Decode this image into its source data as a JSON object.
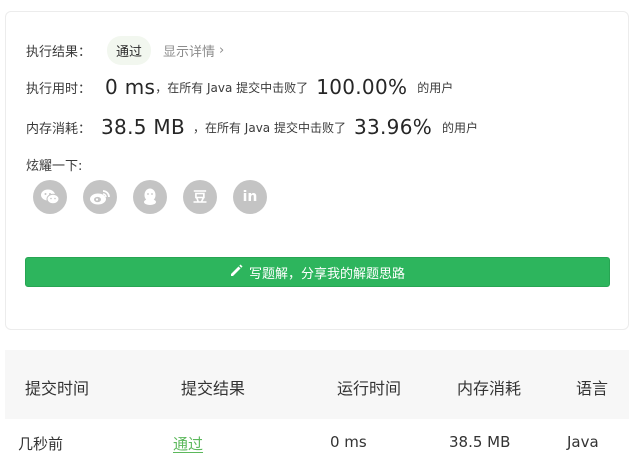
{
  "result": {
    "label": "执行结果：",
    "status": "通过",
    "details_link": "显示详情",
    "chevron": "›"
  },
  "runtime": {
    "label": "执行用时：",
    "value": "0 ms",
    "prefix": "，在所有 Java 提交中击败了",
    "percent": "100.00%",
    "suffix": "的用户"
  },
  "memory": {
    "label": "内存消耗：",
    "value": "38.5 MB",
    "prefix": "，在所有 Java 提交中击败了",
    "percent": "33.96%",
    "suffix": "的用户"
  },
  "share": {
    "label": "炫耀一下:",
    "icons": [
      "wechat-icon",
      "weibo-icon",
      "qq-icon",
      "douban-icon",
      "linkedin-icon"
    ],
    "douban_glyph": "豆",
    "linkedin_glyph": "in",
    "button_label": "写题解，分享我的解题思路"
  },
  "table": {
    "headers": [
      "提交时间",
      "提交结果",
      "运行时间",
      "内存消耗",
      "语言"
    ],
    "rows": [
      [
        "几秒前",
        "通过",
        "0 ms",
        "38.5 MB",
        "Java"
      ]
    ]
  },
  "colors": {
    "accent_green": "#2db55d",
    "pass_text": "#5cb85c",
    "icon_grey": "#c4c4c4"
  }
}
